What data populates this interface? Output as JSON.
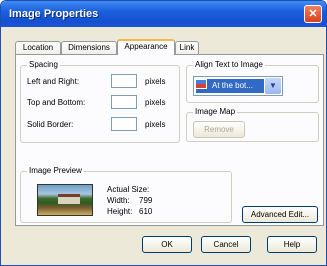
{
  "window": {
    "title": "Image Properties",
    "close": "✕"
  },
  "tabs": [
    "Location",
    "Dimensions",
    "Appearance",
    "Link"
  ],
  "spacing": {
    "title": "Spacing",
    "left_right_label": "Left and Right:",
    "top_bottom_label": "Top and Bottom:",
    "solid_border_label": "Solid Border:",
    "unit": "pixels",
    "left_right_value": "",
    "top_bottom_value": "",
    "solid_border_value": ""
  },
  "align": {
    "title": "Align Text to Image",
    "selected": "At the bot...",
    "arrow": "▼"
  },
  "image_map": {
    "title": "Image Map",
    "remove_label": "Remove"
  },
  "preview": {
    "title": "Image Preview",
    "actual_size_label": "Actual Size:",
    "width_label": "Width:",
    "width_value": "799",
    "height_label": "Height:",
    "height_value": "610"
  },
  "buttons": {
    "advanced_edit": "Advanced Edit...",
    "ok": "OK",
    "cancel": "Cancel",
    "help": "Help"
  }
}
